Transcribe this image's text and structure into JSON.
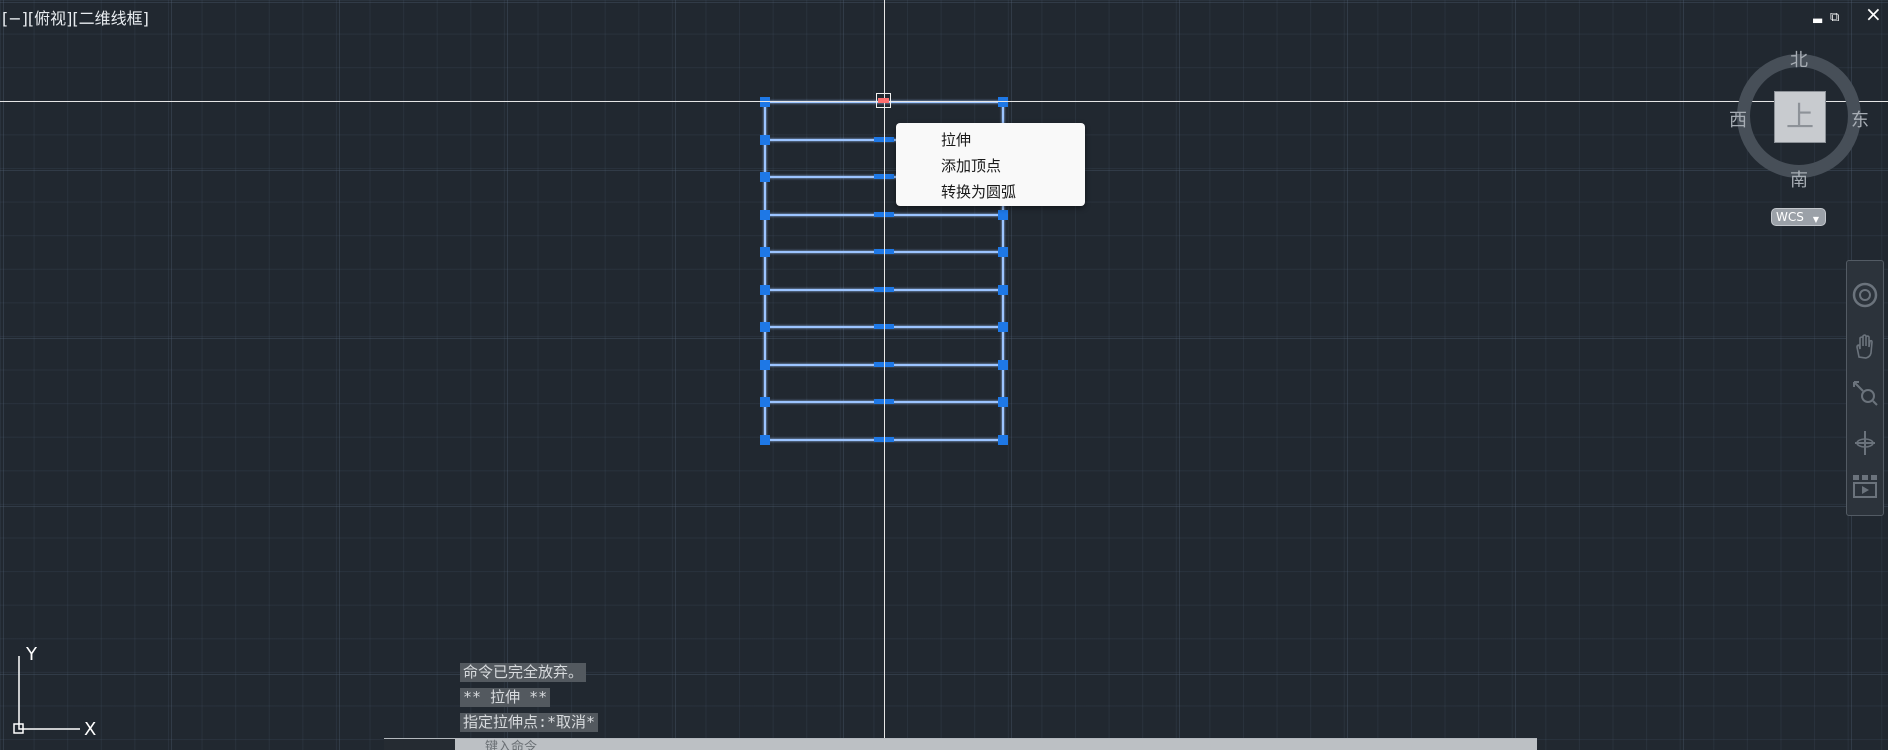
{
  "viewport": {
    "label": "[−][俯视][二维线框]"
  },
  "context_menu": {
    "items": [
      "拉伸",
      "添加顶点",
      "转换为圆弧"
    ]
  },
  "viewcube": {
    "face_label": "上",
    "north": "北",
    "south": "南",
    "east": "东",
    "west": "西",
    "ucs_menu_label": "WCS"
  },
  "window_controls": {
    "minimize_icon": "minimize-icon",
    "restore_icon": "restore-icon",
    "close_label": "×"
  },
  "ucs": {
    "x_label": "X",
    "y_label": "Y"
  },
  "command_history": {
    "lines": [
      "命令已完全放弃。",
      "** 拉伸 **",
      "指定拉伸点:*取消*"
    ]
  },
  "command_line": {
    "placeholder": "键入命令"
  },
  "navigation_bar": {
    "tools": [
      "steering-wheel-icon",
      "pan-icon",
      "zoom-extents-icon",
      "orbit-icon",
      "showmotion-icon"
    ]
  },
  "colors": {
    "background": "#212830",
    "selection_blue": "#1e78e6",
    "line_glow": "#7db4ff",
    "menu_bg": "#f9f9f9",
    "grip_hot": "#ff6f6f"
  }
}
